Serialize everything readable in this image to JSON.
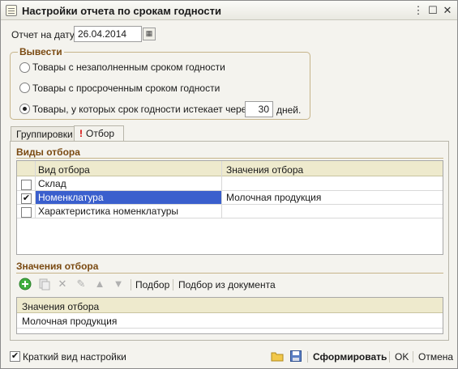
{
  "window": {
    "title": "Настройки отчета по срокам годности",
    "more_label": "⋮",
    "maximize_label": "☐",
    "close_label": "✕"
  },
  "report_date": {
    "label": "Отчет на дату:",
    "value": "26.04.2014"
  },
  "output": {
    "caption": "Вывести",
    "options": [
      {
        "label": "Товары с незаполненным сроком годности",
        "selected": false
      },
      {
        "label": "Товары с просроченным сроком годности",
        "selected": false
      },
      {
        "label": "Товары, у которых срок годности истекает через:",
        "selected": true
      }
    ],
    "days_value": "30",
    "days_unit": "дней."
  },
  "tabs": [
    {
      "label": "Группировки",
      "active": false
    },
    {
      "label": "Отбор",
      "active": true,
      "marker": "!"
    }
  ],
  "filter_types": {
    "section_title": "Виды отбора",
    "columns": [
      "Вид отбора",
      "Значения отбора"
    ],
    "rows": [
      {
        "checked": false,
        "name": "Склад",
        "value": ""
      },
      {
        "checked": true,
        "name": "Номенклатура",
        "value": "Молочная продукция"
      },
      {
        "checked": false,
        "name": "Характеристика номенклатуры",
        "value": ""
      }
    ]
  },
  "filter_values": {
    "section_title": "Значения отбора",
    "toolbar": {
      "add_icon": "add-icon",
      "copy_icon": "copy-icon",
      "delete_icon": "delete-icon",
      "edit_icon": "edit-icon",
      "up_icon": "move-up-icon",
      "down_icon": "move-down-icon",
      "pick_label": "Подбор",
      "pick_from_doc_label": "Подбор из документа"
    },
    "column": "Значения отбора",
    "rows": [
      "Молочная продукция"
    ]
  },
  "footer": {
    "brief_view_label": "Краткий вид настройки",
    "brief_view_checked": true,
    "open_icon": "folder-open-icon",
    "save_icon": "save-icon",
    "generate_label": "Сформировать",
    "ok_label": "OK",
    "cancel_label": "Отмена"
  },
  "colors": {
    "accent_brown": "#7a4a12",
    "selection_blue": "#3a5fcd",
    "grid_header": "#eeeacd",
    "window_bg": "#f4f3ee"
  }
}
